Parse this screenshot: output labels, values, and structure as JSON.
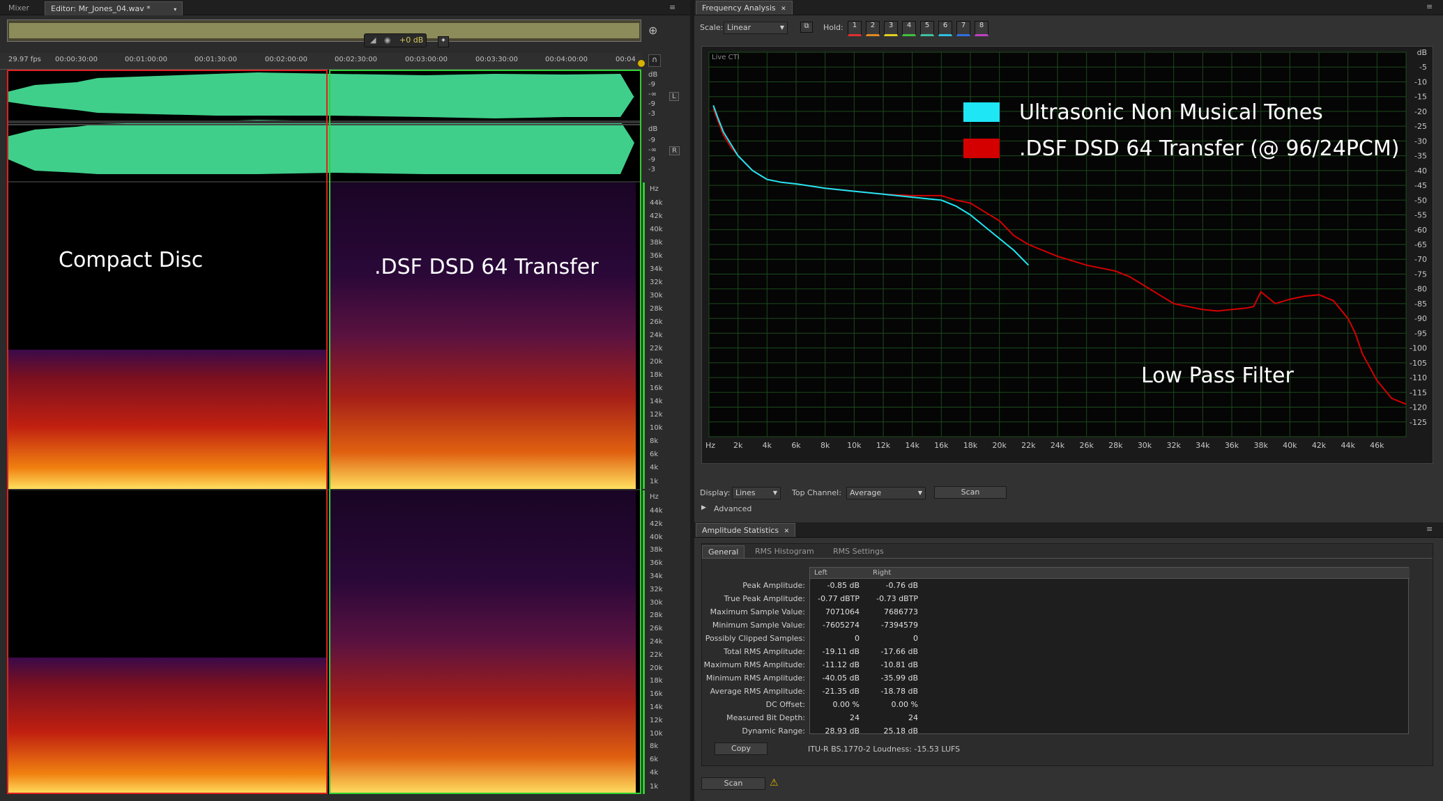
{
  "left_panel": {
    "tabs": [
      "Mixer",
      "Editor: Mr_Jones_04.wav *"
    ],
    "overview_gain": "+0 dB",
    "fps": "29.97 fps",
    "timecodes": [
      "00:00:30:00",
      "00:01:00:00",
      "00:01:30:00",
      "00:02:00:00",
      "00:02:30:00",
      "00:03:00:00",
      "00:03:30:00",
      "00:04:00:00",
      "00:04"
    ],
    "db_ticks_top": [
      "dB",
      "-9",
      "-∞",
      "-9",
      "-3"
    ],
    "db_ticks_bottom": [
      "dB",
      "-9",
      "-∞",
      "-9",
      "-3"
    ],
    "channel_left": "L",
    "channel_right": "R",
    "hz_ticks": [
      "Hz",
      "44k",
      "42k",
      "40k",
      "38k",
      "36k",
      "34k",
      "32k",
      "30k",
      "28k",
      "26k",
      "24k",
      "22k",
      "20k",
      "18k",
      "16k",
      "14k",
      "12k",
      "10k",
      "8k",
      "6k",
      "4k",
      "1k"
    ],
    "annotation_cd": "Compact Disc",
    "annotation_dsf": ".DSF DSD 64 Transfer"
  },
  "freq_panel": {
    "title": "Frequency Analysis",
    "scale_label": "Scale:",
    "scale_value": "Linear",
    "hold_label": "Hold:",
    "hold_buttons": [
      "1",
      "2",
      "3",
      "4",
      "5",
      "6",
      "7",
      "8"
    ],
    "hold_colors": [
      "#e03030",
      "#e08a20",
      "#e0d020",
      "#40c040",
      "#40c0a0",
      "#30c0e0",
      "#3070e0",
      "#c040c0"
    ],
    "live_label": "Live CTI",
    "legend": [
      {
        "name": "Ultrasonic Non Musical Tones",
        "color": "#1ee6f5"
      },
      {
        "name": ".DSF DSD 64 Transfer (@ 96/24PCM)",
        "color": "#d40000"
      }
    ],
    "annotation_lpf": "Low Pass Filter",
    "x_ticks": [
      "Hz",
      "2k",
      "4k",
      "6k",
      "8k",
      "10k",
      "12k",
      "14k",
      "16k",
      "18k",
      "20k",
      "22k",
      "24k",
      "26k",
      "28k",
      "30k",
      "32k",
      "34k",
      "36k",
      "38k",
      "40k",
      "42k",
      "44k",
      "46k"
    ],
    "y_ticks": [
      "dB",
      "-5",
      "-10",
      "-15",
      "-20",
      "-25",
      "-30",
      "-35",
      "-40",
      "-45",
      "-50",
      "-55",
      "-60",
      "-65",
      "-70",
      "-75",
      "-80",
      "-85",
      "-90",
      "-95",
      "-100",
      "-105",
      "-110",
      "-115",
      "-120",
      "-125"
    ],
    "display_label": "Display:",
    "display_value": "Lines",
    "top_channel_label": "Top Channel:",
    "top_channel_value": "Average",
    "scan_label": "Scan",
    "advanced_label": "Advanced"
  },
  "chart_data": {
    "type": "line",
    "xlabel": "",
    "ylabel": "",
    "xlim": [
      0,
      48000
    ],
    "ylim": [
      -130,
      0
    ],
    "series": [
      {
        "name": ".DSF DSD 64 Transfer (@ 96/24PCM)",
        "color": "#d40000",
        "x": [
          300,
          600,
          1000,
          1500,
          2000,
          3000,
          4000,
          5000,
          6000,
          8000,
          10000,
          12000,
          14000,
          15000,
          16000,
          17000,
          18000,
          19000,
          20000,
          21000,
          22000,
          24000,
          26000,
          28000,
          29000,
          30000,
          31000,
          32000,
          33000,
          34000,
          35000,
          36000,
          37000,
          37500,
          38000,
          39000,
          40000,
          41000,
          42000,
          43000,
          44000,
          44500,
          45000,
          46000,
          47000,
          48000
        ],
        "y": [
          -19,
          -23,
          -28,
          -32,
          -35,
          -40,
          -43,
          -44,
          -44.5,
          -46,
          -47,
          -48,
          -48.5,
          -48.5,
          -48.5,
          -50,
          -51,
          -54,
          -57,
          -62,
          -65,
          -69,
          -72,
          -74,
          -76,
          -79,
          -82,
          -85,
          -86,
          -87,
          -87.5,
          -87,
          -86.5,
          -86,
          -81,
          -85,
          -83.5,
          -82.5,
          -82,
          -84,
          -90,
          -95,
          -102,
          -111,
          -117,
          -119
        ]
      },
      {
        "name": "Ultrasonic Non Musical Tones",
        "color": "#1ee6f5",
        "x": [
          300,
          600,
          1000,
          1500,
          2000,
          3000,
          4000,
          5000,
          6000,
          8000,
          10000,
          12000,
          14000,
          15000,
          16000,
          17000,
          18000,
          19000,
          20000,
          21000,
          22000
        ],
        "y": [
          -18,
          -22,
          -27,
          -31,
          -35,
          -40,
          -43,
          -44,
          -44.5,
          -46,
          -47,
          -48,
          -49,
          -49.5,
          -50,
          -52,
          -55,
          -59,
          -63,
          -67,
          -72
        ]
      }
    ]
  },
  "amp_panel": {
    "title": "Amplitude Statistics",
    "tabs": [
      "General",
      "RMS Histogram",
      "RMS Settings"
    ],
    "col_left": "Left",
    "col_right": "Right",
    "rows": [
      {
        "label": "Peak Amplitude:",
        "left": "-0.85 dB",
        "right": "-0.76 dB"
      },
      {
        "label": "True Peak Amplitude:",
        "left": "-0.77 dBTP",
        "right": "-0.73 dBTP"
      },
      {
        "label": "Maximum Sample Value:",
        "left": "7071064",
        "right": "7686773"
      },
      {
        "label": "Minimum Sample Value:",
        "left": "-7605274",
        "right": "-7394579"
      },
      {
        "label": "Possibly Clipped Samples:",
        "left": "0",
        "right": "0"
      },
      {
        "label": "Total RMS Amplitude:",
        "left": "-19.11 dB",
        "right": "-17.66 dB"
      },
      {
        "label": "Maximum RMS Amplitude:",
        "left": "-11.12 dB",
        "right": "-10.81 dB"
      },
      {
        "label": "Minimum RMS Amplitude:",
        "left": "-40.05 dB",
        "right": "-35.99 dB"
      },
      {
        "label": "Average RMS Amplitude:",
        "left": "-21.35 dB",
        "right": "-18.78 dB"
      },
      {
        "label": "DC Offset:",
        "left": "0.00 %",
        "right": "0.00 %"
      },
      {
        "label": "Measured Bit Depth:",
        "left": "24",
        "right": "24"
      },
      {
        "label": "Dynamic Range:",
        "left": "28.93 dB",
        "right": "25.18 dB"
      }
    ],
    "copy_label": "Copy",
    "loudness": "ITU-R BS.1770-2 Loudness: -15.53 LUFS",
    "scan_label": "Scan"
  }
}
